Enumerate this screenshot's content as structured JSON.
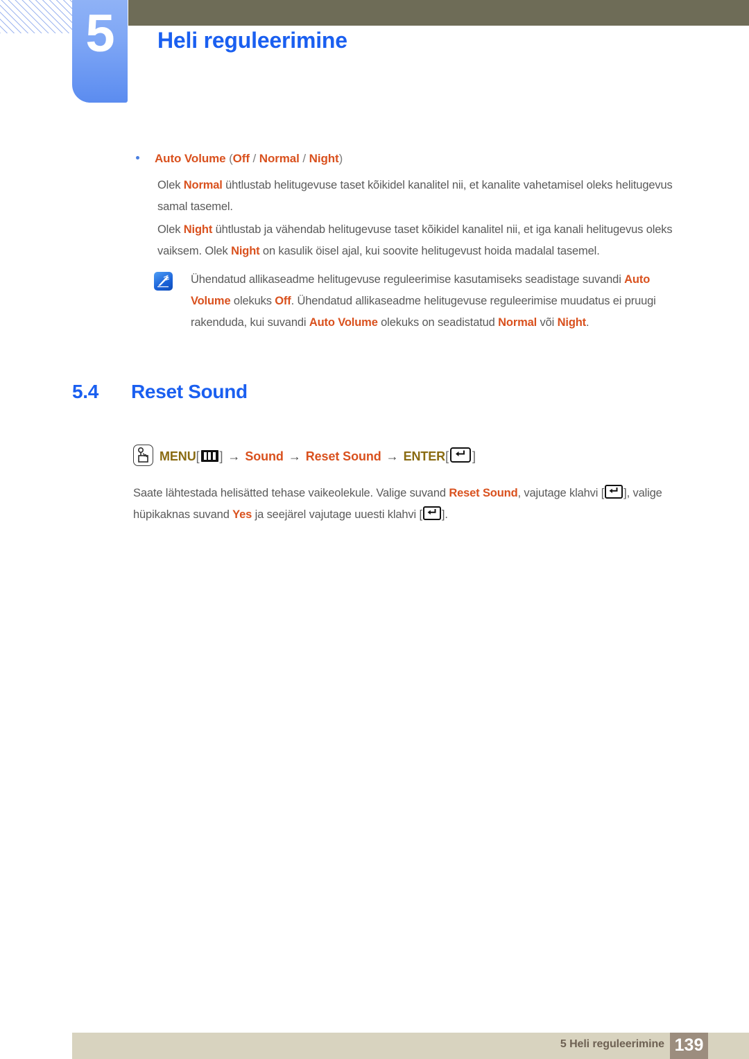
{
  "header": {
    "chapter_number": "5",
    "chapter_title": "Heli reguleerimine",
    "tab_color": "#6e92f3",
    "bar_color": "#6e6c57",
    "title_color": "#1a5ff0"
  },
  "bullet": {
    "label": "Auto Volume",
    "open_paren": " (",
    "option_1": "Off",
    "sep_1": " / ",
    "option_2": "Normal",
    "sep_2": " / ",
    "option_3": "Night",
    "close_paren": ")"
  },
  "paragraphs": {
    "p1_a": "Olek ",
    "p1_b": "Normal",
    "p1_c": " ühtlustab helitugevuse taset kõikidel kanalitel nii, et kanalite vahetamisel oleks helitugevus samal tasemel.",
    "p2_a": "Olek ",
    "p2_b": "Night",
    "p2_c": " ühtlustab ja vähendab helitugevuse taset kõikidel kanalitel nii, et iga kanali helitugevus oleks vaiksem. Olek ",
    "p2_d": "Night",
    "p2_e": " on kasulik öisel ajal, kui soovite helitugevust hoida madalal tasemel."
  },
  "note": {
    "icon": "note-pen-icon",
    "a": "Ühendatud allikaseadme helitugevuse reguleerimise kasutamiseks seadistage suvandi ",
    "b": "Auto Volume",
    "c": " olekuks ",
    "d": "Off",
    "e": ". Ühendatud allikaseadme helitugevuse reguleerimise muudatus ei pruugi rakenduda, kui suvandi ",
    "f": "Auto Volume",
    "g": " olekuks on seadistatud ",
    "h": "Normal",
    "i": " või ",
    "j": "Night",
    "k": "."
  },
  "section": {
    "number": "5.4",
    "title": "Reset Sound"
  },
  "menu_path": {
    "remote_icon": "remote-hand-icon",
    "menu_label": "MENU",
    "bracket_open": "[",
    "menu_icon": "menu-button-icon",
    "bracket_close": "]",
    "arrow": "→",
    "item_1": "Sound",
    "item_2": "Reset Sound",
    "enter_label": "ENTER",
    "enter_icon": "enter-key-icon"
  },
  "body": {
    "b1": "Saate lähtestada helisätted tehase vaikeolekule. Valige suvand ",
    "b2": "Reset Sound",
    "b3": ", vajutage klahvi [",
    "b4": "], valige hüpikaknas suvand ",
    "b5": "Yes",
    "b6": " ja seejärel vajutage uuesti klahvi [",
    "b7": "]."
  },
  "footer": {
    "text": "5 Heli reguleerimine",
    "page_number": "139",
    "bar_color": "#d8d3bf",
    "page_box_color": "#9c8d7e"
  },
  "colors": {
    "highlight_orange": "#d9511e",
    "heading_blue": "#1a5ff0",
    "menu_olive": "#8a6b12",
    "body_gray": "#5a5a5a"
  }
}
